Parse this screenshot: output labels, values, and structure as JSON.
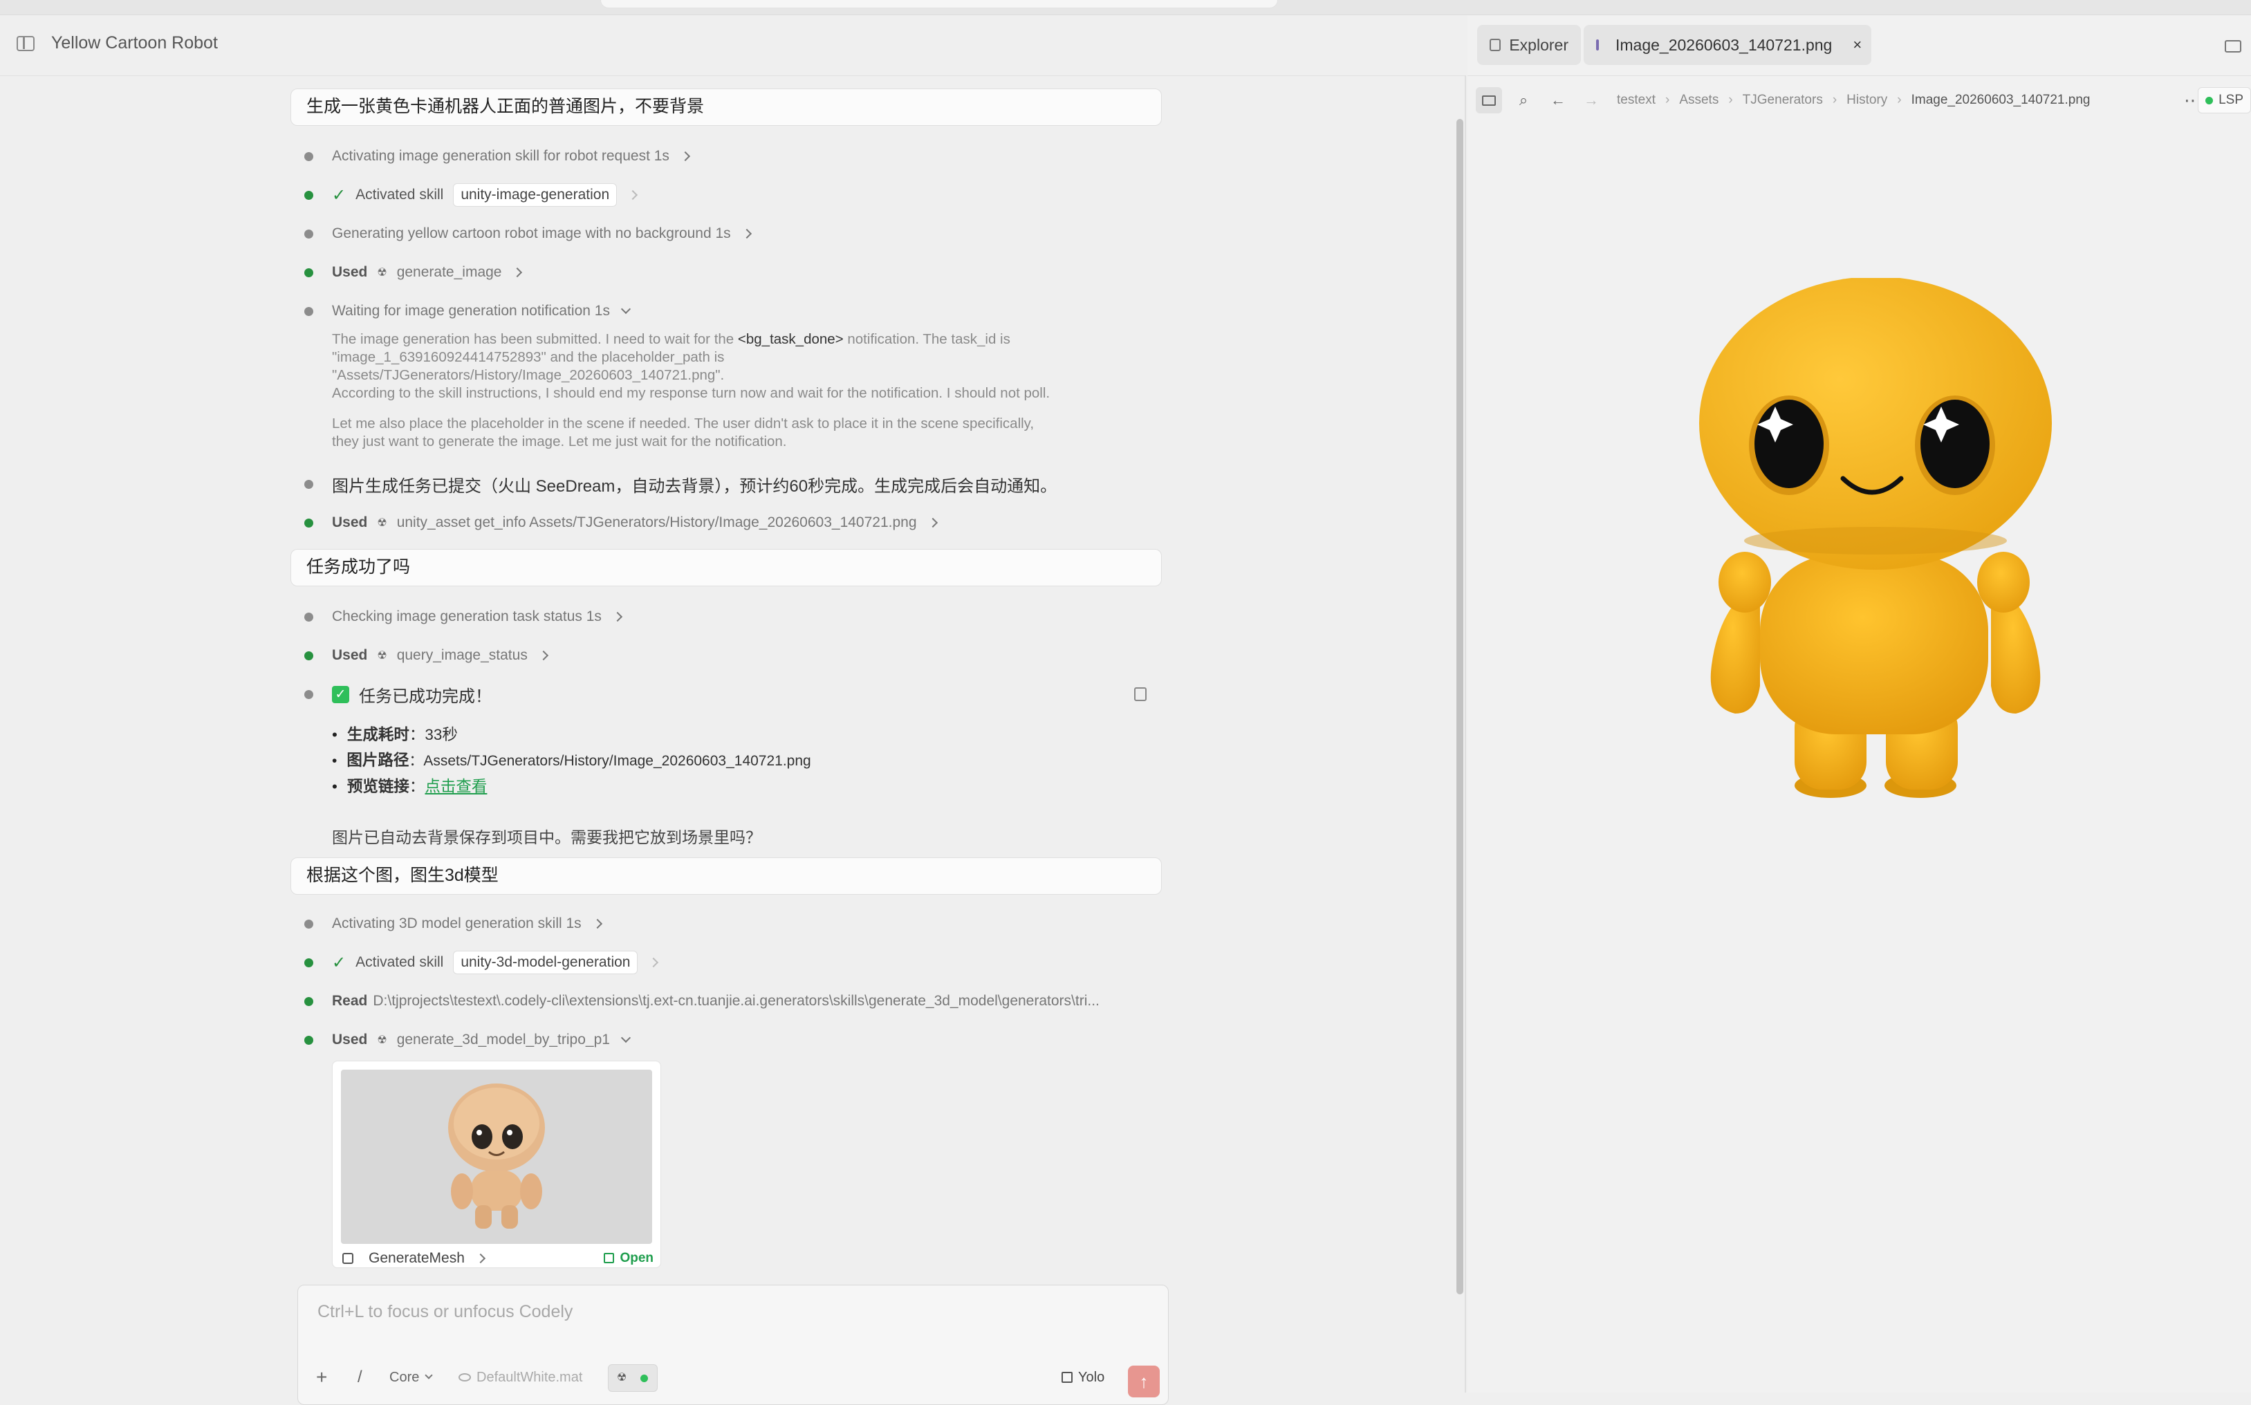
{
  "window": {
    "title": "Yellow Cartoon Robot"
  },
  "chat": {
    "msg1": "生成一张黄色卡通机器人正面的普通图片，不要背景",
    "r1": "Activating image generation skill for robot request 1s",
    "r2_label": "Activated skill",
    "r2_skill": "unity-image-generation",
    "r3": "Generating yellow cartoon robot image with no background 1s",
    "r4_label": "Used",
    "r4_tool": "generate_image",
    "r5": "Waiting for image generation notification 1s",
    "thought_a1": "The image generation has been submitted. I need to wait for the",
    "thought_a_tag": "<bg_task_done>",
    "thought_a2": "notification. The task_id is",
    "thought_b": "\"image_1_639160924414752893\" and the placeholder_path is",
    "thought_c": "\"Assets/TJGenerators/History/Image_20260603_140721.png\".",
    "thought_d": "According to the skill instructions, I should end my response turn now and wait for the notification. I should not poll.",
    "thought_e": "Let me also place the placeholder in the scene if needed. The user didn't ask to place it in the scene specifically,",
    "thought_f": "they just want to generate the image. Let me just wait for the notification.",
    "r6": "图片生成任务已提交（火山 SeeDream，自动去背景），预计约60秒完成。生成完成后会自动通知。",
    "r7_label": "Used",
    "r7_tool": "unity_asset get_info Assets/TJGenerators/History/Image_20260603_140721.png",
    "msg2": "任务成功了吗",
    "r8": "Checking image generation task status 1s",
    "r9_label": "Used",
    "r9_tool": "query_image_status",
    "r10": "任务已成功完成！",
    "b1_k": "生成耗时",
    "b1_v": "：33秒",
    "b2_k": "图片路径",
    "b2_v": "：Assets/TJGenerators/History/Image_20260603_140721.png",
    "b3_k": "预览链接",
    "b3_colon": "：",
    "b3_link": "点击查看",
    "para1": "图片已自动去背景保存到项目中。需要我把它放到场景里吗？",
    "msg3": "根据这个图，图生3d模型",
    "r11": "Activating 3D model generation skill 1s",
    "r12_label": "Activated skill",
    "r12_skill": "unity-3d-model-generation",
    "r13_label": "Read",
    "r13_path": "D:\\tjprojects\\testext\\.codely-cli\\extensions\\tj.ext-cn.tuanjie.ai.generators\\skills\\generate_3d_model\\generators\\tri...",
    "r14_label": "Used",
    "r14_tool": "generate_3d_model_by_tripo_p1",
    "card_title": "GenerateMesh",
    "card_open": "Open"
  },
  "composer": {
    "placeholder": "Ctrl+L to focus or unfocus Codely",
    "plus": "+",
    "slash": "/",
    "mode": "Core",
    "material": "DefaultWhite.mat",
    "yolo": "Yolo",
    "send": "↑"
  },
  "right": {
    "tab_explorer": "Explorer",
    "tab_image": "Image_20260603_140721.png",
    "tab_close": "×",
    "crumbs": [
      "testext",
      "Assets",
      "TJGenerators",
      "History",
      "Image_20260603_140721.png"
    ],
    "more": "⋯",
    "lsp": "LSP"
  },
  "colors": {
    "accent_green": "#27913f",
    "link_green": "#1f9e4d",
    "send_btn": "#e79690",
    "robot_yellow": "#f5b21a"
  }
}
